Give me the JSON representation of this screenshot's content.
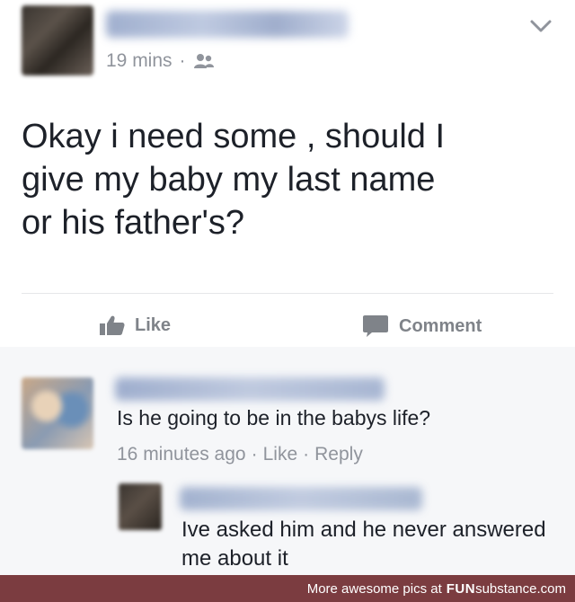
{
  "post": {
    "time": "19 mins",
    "separator": "·",
    "audience_icon": "friends-icon",
    "text": "Okay i need some , should I\ngive my baby my last name\nor his father's?"
  },
  "actions": {
    "like_label": "Like",
    "comment_label": "Comment"
  },
  "comments": [
    {
      "text": "Is he going to be in the babys life?",
      "time": "16 minutes ago",
      "like_label": "Like",
      "reply_label": "Reply",
      "sep": "·"
    },
    {
      "text": "Ive asked him and he never answered me about it"
    }
  ],
  "footer": {
    "prefix": "More awesome pics at",
    "brand_bold": "FUN",
    "brand_rest": "substance",
    "suffix": ".com"
  },
  "colors": {
    "meta_gray": "#90949c",
    "text": "#1d2129",
    "footer_bg": "#7b3c40"
  }
}
